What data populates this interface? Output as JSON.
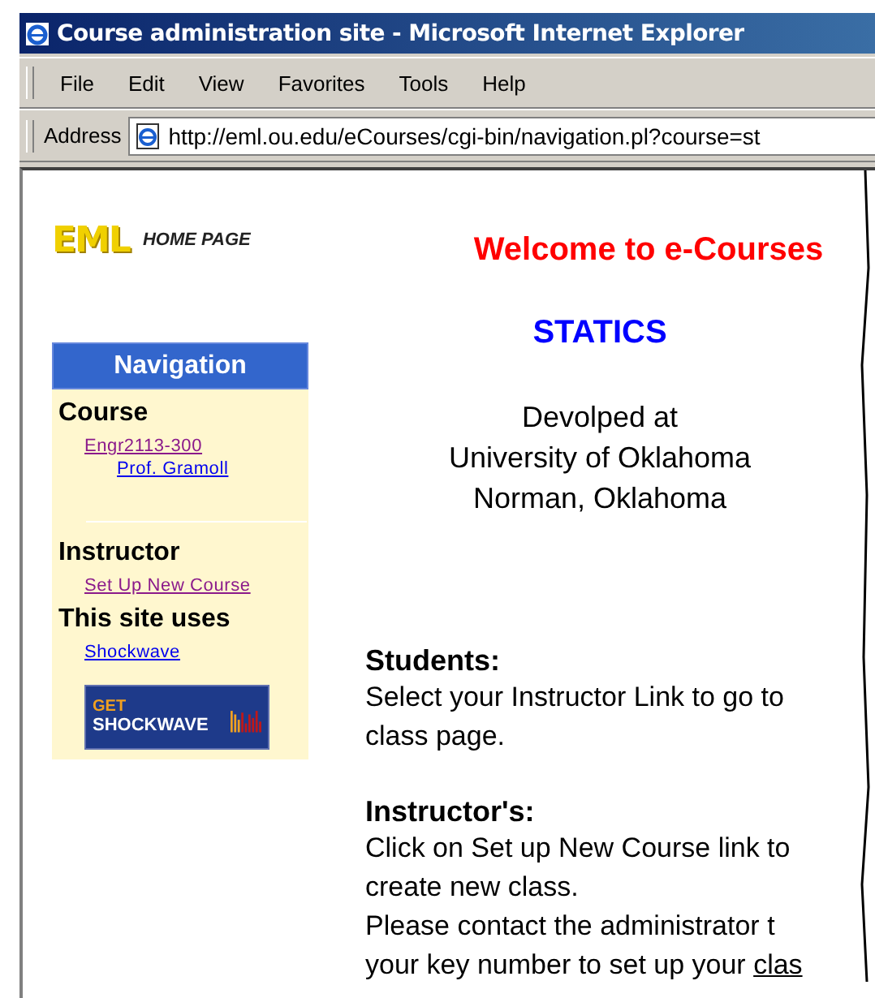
{
  "window": {
    "title": "Course administration site - Microsoft Internet Explorer"
  },
  "menu": [
    "File",
    "Edit",
    "View",
    "Favorites",
    "Tools",
    "Help"
  ],
  "address": {
    "label": "Address",
    "value": "http://eml.ou.edu/eCourses/cgi-bin/navigation.pl?course=st"
  },
  "logo": {
    "mark": "EML",
    "caption": "HOME PAGE"
  },
  "navigation": {
    "title": "Navigation",
    "sections": [
      {
        "heading": "Course",
        "links": [
          {
            "label": "Engr2113-300",
            "visited": true,
            "children": [
              {
                "label": "Prof. Gramoll",
                "visited": false
              }
            ]
          }
        ]
      },
      {
        "heading": "Instructor",
        "links": [
          {
            "label": "Set Up New Course",
            "visited": true
          }
        ]
      },
      {
        "heading": "This site uses",
        "links": [
          {
            "label": "Shockwave",
            "visited": false
          }
        ]
      }
    ],
    "badge": {
      "top": "GET",
      "bottom": "SHOCKWAVE"
    }
  },
  "main": {
    "welcome": "Welcome to e-Courses",
    "course": "STATICS",
    "credits": [
      "Devolped at",
      "University of Oklahoma",
      "Norman, Oklahoma"
    ],
    "sections": [
      {
        "heading": "Students:",
        "lines": [
          {
            "text": "Select your Instructor Link to go to"
          },
          {
            "text": "class page."
          }
        ]
      },
      {
        "heading": "Instructor's:",
        "lines": [
          {
            "text": "Click on Set up New Course link to"
          },
          {
            "text": "create new class."
          },
          {
            "text": "Please contact the administrator t"
          },
          {
            "text": "your key number to set up your ",
            "link": "clas"
          }
        ]
      }
    ]
  }
}
